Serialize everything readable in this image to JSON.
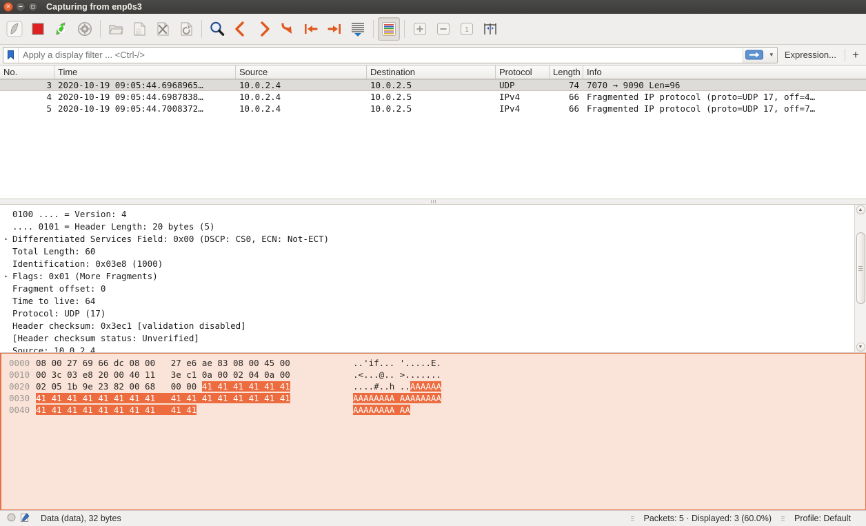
{
  "window": {
    "title": "Capturing from enp0s3",
    "controls": [
      "close",
      "minimize",
      "maximize"
    ]
  },
  "toolbar": {
    "items": [
      {
        "name": "start-capture-button",
        "icon": "shark-fin-icon",
        "label": "Start",
        "enabled": false
      },
      {
        "name": "stop-capture-button",
        "icon": "stop-square-icon",
        "label": "Stop",
        "enabled": true
      },
      {
        "name": "restart-capture-button",
        "icon": "restart-fin-icon",
        "label": "Restart",
        "enabled": true
      },
      {
        "name": "capture-options-button",
        "icon": "gear-icon",
        "label": "Capture options",
        "enabled": true
      },
      {
        "name": "open-file-button",
        "icon": "folder-icon",
        "label": "Open",
        "enabled": false
      },
      {
        "name": "save-file-button",
        "icon": "save-file-icon",
        "label": "Save",
        "enabled": false
      },
      {
        "name": "close-file-button",
        "icon": "close-file-icon",
        "label": "Close",
        "enabled": false
      },
      {
        "name": "reload-file-button",
        "icon": "reload-icon",
        "label": "Reload",
        "enabled": false
      },
      {
        "name": "find-packet-button",
        "icon": "magnifier-icon",
        "label": "Find packet",
        "enabled": true
      },
      {
        "name": "go-back-button",
        "icon": "chevron-left-icon",
        "label": "Go back",
        "enabled": true
      },
      {
        "name": "go-forward-button",
        "icon": "chevron-right-icon",
        "label": "Go forward",
        "enabled": true
      },
      {
        "name": "go-to-packet-button",
        "icon": "goto-arrow-icon",
        "label": "Go to packet",
        "enabled": true
      },
      {
        "name": "go-to-first-packet-button",
        "icon": "arrow-to-start-icon",
        "label": "First packet",
        "enabled": true
      },
      {
        "name": "go-to-last-packet-button",
        "icon": "arrow-to-end-icon",
        "label": "Last packet",
        "enabled": true
      },
      {
        "name": "auto-scroll-button",
        "icon": "auto-scroll-icon",
        "label": "Auto scroll",
        "enabled": true
      },
      {
        "name": "colorize-button",
        "icon": "colorize-icon",
        "label": "Colorize",
        "enabled": true,
        "pressed": true
      },
      {
        "name": "zoom-in-button",
        "icon": "zoom-in-icon",
        "label": "Zoom in",
        "enabled": false
      },
      {
        "name": "zoom-out-button",
        "icon": "zoom-out-icon",
        "label": "Zoom out",
        "enabled": false
      },
      {
        "name": "zoom-reset-button",
        "icon": "zoom-reset-icon",
        "label": "Normal size",
        "enabled": false
      },
      {
        "name": "resize-columns-button",
        "icon": "resize-columns-icon",
        "label": "Resize columns",
        "enabled": true
      }
    ]
  },
  "filter": {
    "bookmark_icon": "bookmark-icon",
    "placeholder": "Apply a display filter ... <Ctrl-/>",
    "value": "",
    "apply_icon": "arrow-right-icon",
    "dropdown_icon": "chevron-down-icon",
    "expression_label": "Expression...",
    "add_label": "+"
  },
  "packet_list": {
    "columns": [
      "No.",
      "Time",
      "Source",
      "Destination",
      "Protocol",
      "Length",
      "Info"
    ],
    "rows": [
      {
        "no": "3",
        "time": "2020-10-19 09:05:44.6968965…",
        "source": "10.0.2.4",
        "destination": "10.0.2.5",
        "protocol": "UDP",
        "length": "74",
        "info": "7070 → 9090 Len=96",
        "selected": true
      },
      {
        "no": "4",
        "time": "2020-10-19 09:05:44.6987838…",
        "source": "10.0.2.4",
        "destination": "10.0.2.5",
        "protocol": "IPv4",
        "length": "66",
        "info": "Fragmented IP protocol (proto=UDP 17, off=4…",
        "selected": false
      },
      {
        "no": "5",
        "time": "2020-10-19 09:05:44.7008372…",
        "source": "10.0.2.4",
        "destination": "10.0.2.5",
        "protocol": "IPv4",
        "length": "66",
        "info": "Fragmented IP protocol (proto=UDP 17, off=7…",
        "selected": false
      }
    ]
  },
  "packet_detail": {
    "lines": [
      {
        "expander": "",
        "text": "0100 .... = Version: 4"
      },
      {
        "expander": "",
        "text": ".... 0101 = Header Length: 20 bytes (5)"
      },
      {
        "expander": "▸",
        "text": "Differentiated Services Field: 0x00 (DSCP: CS0, ECN: Not-ECT)"
      },
      {
        "expander": "",
        "text": "Total Length: 60"
      },
      {
        "expander": "",
        "text": "Identification: 0x03e8 (1000)"
      },
      {
        "expander": "▸",
        "text": "Flags: 0x01 (More Fragments)"
      },
      {
        "expander": "",
        "text": "Fragment offset: 0"
      },
      {
        "expander": "",
        "text": "Time to live: 64"
      },
      {
        "expander": "",
        "text": "Protocol: UDP (17)"
      },
      {
        "expander": "",
        "text": "Header checksum: 0x3ec1 [validation disabled]"
      },
      {
        "expander": "",
        "text": "[Header checksum status: Unverified]"
      },
      {
        "expander": "",
        "text": "Source: 10.0.2.4"
      }
    ]
  },
  "hex_dump": {
    "rows": [
      {
        "offset": "0000",
        "bytes": [
          "08",
          "00",
          "27",
          "69",
          "66",
          "dc",
          "08",
          "00",
          "27",
          "e6",
          "ae",
          "83",
          "08",
          "00",
          "45",
          "00"
        ],
        "highlight": [
          false,
          false,
          false,
          false,
          false,
          false,
          false,
          false,
          false,
          false,
          false,
          false,
          false,
          false,
          false,
          false
        ],
        "ascii": [
          ".",
          ".",
          "'",
          "i",
          "f",
          ".",
          ".",
          ".",
          "'",
          ".",
          ".",
          ".",
          ".",
          ".",
          "E",
          "."
        ],
        "ascii_highlight": [
          false,
          false,
          false,
          false,
          false,
          false,
          false,
          false,
          false,
          false,
          false,
          false,
          false,
          false,
          false,
          false
        ]
      },
      {
        "offset": "0010",
        "bytes": [
          "00",
          "3c",
          "03",
          "e8",
          "20",
          "00",
          "40",
          "11",
          "3e",
          "c1",
          "0a",
          "00",
          "02",
          "04",
          "0a",
          "00"
        ],
        "highlight": [
          false,
          false,
          false,
          false,
          false,
          false,
          false,
          false,
          false,
          false,
          false,
          false,
          false,
          false,
          false,
          false
        ],
        "ascii": [
          ".",
          "<",
          ".",
          ".",
          ".",
          "@",
          ".",
          ".",
          ">",
          ".",
          ".",
          ".",
          ".",
          ".",
          ".",
          "."
        ],
        "ascii_highlight": [
          false,
          false,
          false,
          false,
          false,
          false,
          false,
          false,
          false,
          false,
          false,
          false,
          false,
          false,
          false,
          false
        ]
      },
      {
        "offset": "0020",
        "bytes": [
          "02",
          "05",
          "1b",
          "9e",
          "23",
          "82",
          "00",
          "68",
          "00",
          "00",
          "41",
          "41",
          "41",
          "41",
          "41",
          "41"
        ],
        "highlight": [
          false,
          false,
          false,
          false,
          false,
          false,
          false,
          false,
          false,
          false,
          true,
          true,
          true,
          true,
          true,
          true
        ],
        "ascii": [
          ".",
          ".",
          ".",
          ".",
          "#",
          ".",
          ".",
          "h",
          ".",
          ".",
          "A",
          "A",
          "A",
          "A",
          "A",
          "A"
        ],
        "ascii_highlight": [
          false,
          false,
          false,
          false,
          false,
          false,
          false,
          false,
          false,
          false,
          true,
          true,
          true,
          true,
          true,
          true
        ]
      },
      {
        "offset": "0030",
        "bytes": [
          "41",
          "41",
          "41",
          "41",
          "41",
          "41",
          "41",
          "41",
          "41",
          "41",
          "41",
          "41",
          "41",
          "41",
          "41",
          "41"
        ],
        "highlight": [
          true,
          true,
          true,
          true,
          true,
          true,
          true,
          true,
          true,
          true,
          true,
          true,
          true,
          true,
          true,
          true
        ],
        "ascii": [
          "A",
          "A",
          "A",
          "A",
          "A",
          "A",
          "A",
          "A",
          "A",
          "A",
          "A",
          "A",
          "A",
          "A",
          "A",
          "A"
        ],
        "ascii_highlight": [
          true,
          true,
          true,
          true,
          true,
          true,
          true,
          true,
          true,
          true,
          true,
          true,
          true,
          true,
          true,
          true
        ]
      },
      {
        "offset": "0040",
        "bytes": [
          "41",
          "41",
          "41",
          "41",
          "41",
          "41",
          "41",
          "41",
          "41",
          "41"
        ],
        "highlight": [
          true,
          true,
          true,
          true,
          true,
          true,
          true,
          true,
          true,
          true
        ],
        "ascii": [
          "A",
          "A",
          "A",
          "A",
          "A",
          "A",
          "A",
          "A",
          "A",
          "A"
        ],
        "ascii_highlight": [
          true,
          true,
          true,
          true,
          true,
          true,
          true,
          true,
          true,
          true
        ]
      }
    ],
    "highlight_color": "#ec6b3f",
    "background_color": "#fae3d8",
    "border_color": "#e8714a"
  },
  "status_bar": {
    "expert_icon": "expert-info-circle-icon",
    "comment_icon": "capture-comment-icon",
    "field_text": "Data (data), 32 bytes",
    "packets_text": "Packets: 5 · Displayed: 3 (60.0%)",
    "profile_text": "Profile: Default"
  }
}
